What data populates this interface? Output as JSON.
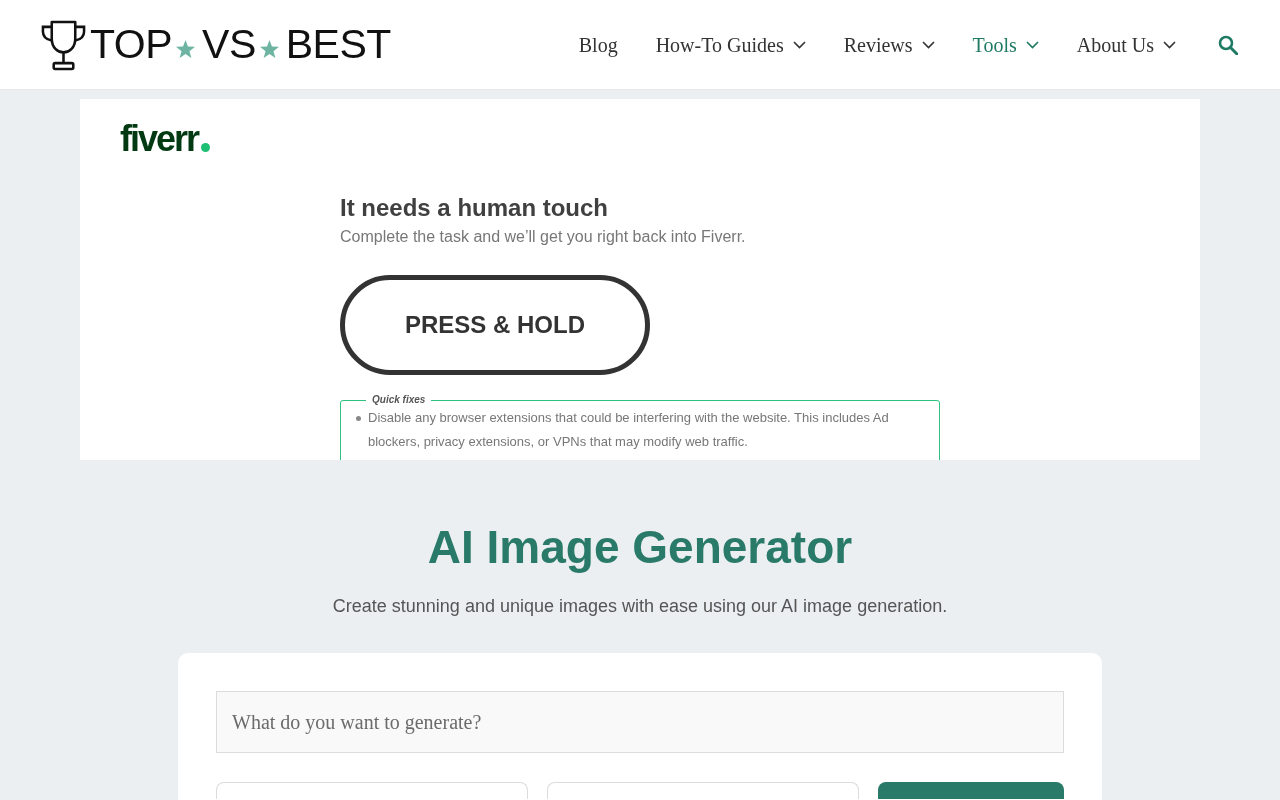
{
  "header": {
    "logo": {
      "words": [
        "TOP",
        "VS",
        "BEST"
      ]
    },
    "nav": [
      {
        "label": "Blog",
        "dropdown": false,
        "selected": false
      },
      {
        "label": "How-To Guides",
        "dropdown": true,
        "selected": false
      },
      {
        "label": "Reviews",
        "dropdown": true,
        "selected": false
      },
      {
        "label": "Tools",
        "dropdown": true,
        "selected": true
      },
      {
        "label": "About Us",
        "dropdown": true,
        "selected": false
      }
    ]
  },
  "challenge": {
    "brand": "fiverr",
    "title": "It needs a human touch",
    "subtitle": "Complete the task and we’ll get you right back into Fiverr.",
    "button": "PRESS & HOLD",
    "quick_fixes": {
      "legend": "Quick fixes",
      "items": [
        "Disable any browser extensions that could be interfering with the website. This includes Ad blockers, privacy extensions, or VPNs that may modify web traffic."
      ]
    }
  },
  "generator": {
    "title": "AI Image Generator",
    "subtitle": "Create stunning and unique images with ease using our AI image generation.",
    "prompt": {
      "placeholder": "What do you want to generate?"
    },
    "controls": [
      {
        "kind": "select"
      },
      {
        "kind": "select"
      },
      {
        "kind": "button"
      }
    ]
  }
}
